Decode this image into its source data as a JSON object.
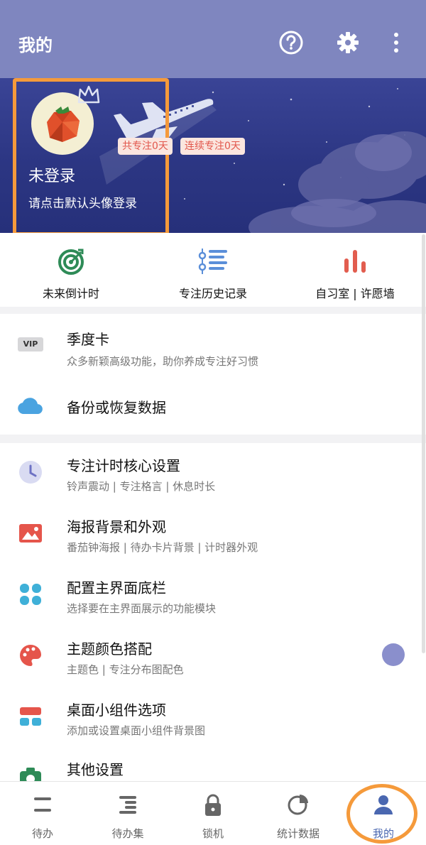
{
  "header": {
    "title": "我的",
    "icons": [
      "help-icon",
      "settings-icon",
      "more-icon"
    ]
  },
  "profile": {
    "title": "未登录",
    "subtitle": "请点击默认头像登录",
    "badge_total": "共专注0天",
    "badge_streak": "连续专注0天"
  },
  "quick_actions": [
    {
      "label": "未来倒计时",
      "icon": "target-icon",
      "color": "#2e8b57"
    },
    {
      "label": "专注历史记录",
      "icon": "list-icon",
      "color": "#5b8fd9"
    },
    {
      "label": "自习室 | 许愿墙",
      "icon": "bar-chart-icon",
      "color": "#e25d4f"
    }
  ],
  "list": {
    "vip": {
      "tag": "VIP",
      "title": "季度卡",
      "subtitle": "众多新颖高级功能，助你养成专注好习惯"
    },
    "backup": {
      "title": "备份或恢复数据"
    },
    "timer": {
      "title": "专注计时核心设置",
      "subtitle": "铃声震动 | 专注格言 | 休息时长"
    },
    "poster": {
      "title": "海报背景和外观",
      "subtitle": "番茄钟海报 | 待办卡片背景 | 计时器外观"
    },
    "layout": {
      "title": "配置主界面底栏",
      "subtitle": "选择要在主界面展示的功能模块"
    },
    "theme": {
      "title": "主题颜色搭配",
      "subtitle": "主题色 | 专注分布图配色"
    },
    "widget": {
      "title": "桌面小组件选项",
      "subtitle": "添加或设置桌面小组件背景图"
    },
    "other": {
      "title": "其他设置"
    }
  },
  "bottom_nav": [
    {
      "label": "待办",
      "icon": "todo-icon"
    },
    {
      "label": "待办集",
      "icon": "todo-collection-icon"
    },
    {
      "label": "锁机",
      "icon": "lock-icon"
    },
    {
      "label": "统计数据",
      "icon": "pie-chart-icon"
    },
    {
      "label": "我的",
      "icon": "user-icon",
      "active": true
    }
  ],
  "colors": {
    "header": "#7f86bf",
    "banner": "#2c3683",
    "highlight": "#f59a3b",
    "active_nav": "#4a67b0"
  }
}
